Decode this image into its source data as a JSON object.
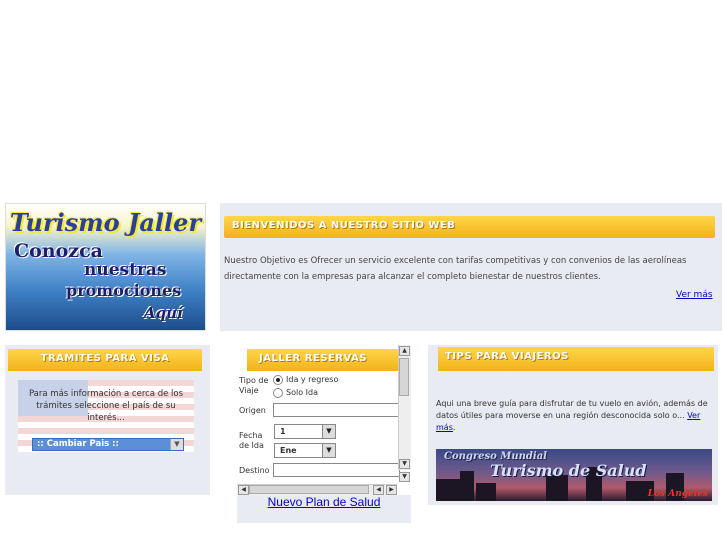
{
  "banner": {
    "title": "Turismo Jaller",
    "line1": "Conozca",
    "line2": "nuestras",
    "line3": "promociones",
    "line4": "Aquí"
  },
  "welcome": {
    "header": "BIENVENIDOS A NUESTRO SITIO WEB",
    "text": "Nuestro Objetivo es Ofrecer un servicio excelente con tarifas competitivas y con convenios de las aerolíneas directamente con la empresas para alcanzar el completo bienestar de nuestros clientes.",
    "more": "Ver más"
  },
  "visa": {
    "header": "TRAMITES PARA VISA",
    "text": "Para más información a cerca de los trámites seleccione el país de su interés...",
    "select_value": ":: Cambiar Pais ::"
  },
  "reservas": {
    "header": "JALLER RESERVAS",
    "tipo_label": "Tipo de Viaje",
    "opt_ida_regreso": "Ida y regreso",
    "opt_solo_ida": "Solo Ida",
    "origen_label": "Origen",
    "fecha_label": "Fecha de Ida",
    "day_value": "1",
    "month_value": "Ene",
    "destino_label": "Destino"
  },
  "salud_link": "Nuevo Plan de Salud",
  "tips": {
    "header": "TIPS PARA VIAJEROS",
    "text": "Aqui una breve guía para disfrutar de tu vuelo en avión, además de datos útiles para moverse en una región desconocida solo o...",
    "more": "Ver más",
    "after_more": "."
  },
  "congreso": {
    "top": "Congreso Mundial",
    "main": "Turismo de Salud",
    "city": "Los Angeles"
  },
  "colors": {
    "header_yellow": "#f2b21b",
    "panel_bg": "#e9ebf2",
    "link_blue": "#0000cc"
  }
}
